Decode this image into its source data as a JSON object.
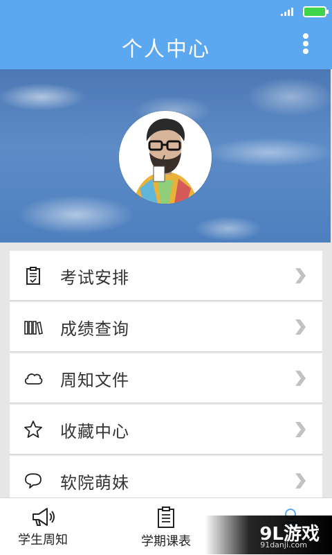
{
  "header": {
    "title": "个人中心"
  },
  "menu": {
    "items": [
      {
        "label": "考试安排",
        "icon": "clipboard-check-icon"
      },
      {
        "label": "成绩查询",
        "icon": "books-icon"
      },
      {
        "label": "周知文件",
        "icon": "cloud-icon"
      },
      {
        "label": "收藏中心",
        "icon": "star-icon"
      },
      {
        "label": "软院萌妹",
        "icon": "chat-bubble-icon"
      }
    ]
  },
  "bottom_nav": {
    "tabs": [
      {
        "label": "学生周知",
        "icon": "megaphone-icon"
      },
      {
        "label": "学期课表",
        "icon": "schedule-icon"
      },
      {
        "label": "",
        "icon": "profile-icon"
      }
    ]
  },
  "watermark": {
    "main": "9L游戏",
    "sub": "91danji.com"
  },
  "colors": {
    "primary": "#5ba8f0",
    "background": "#e6e6e6",
    "battery": "#3fd44a"
  }
}
